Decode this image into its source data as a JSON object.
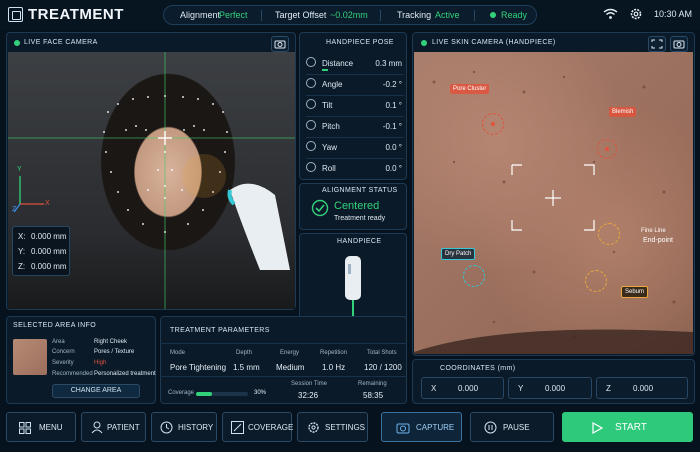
{
  "app": {
    "title": "TREATMENT"
  },
  "status": {
    "alignment_label": "Alignment",
    "alignment_value": "Perfect",
    "target_label": "Target Offset",
    "target_value": "~0.02mm",
    "tracking_label": "Tracking",
    "tracking_value": "Active",
    "ready": "Ready"
  },
  "time": "10:30 AM",
  "face_camera": {
    "title": "LIVE FACE CAMERA",
    "axes": {
      "y": "Y",
      "x": "X",
      "z": "Z"
    },
    "coords": [
      {
        "k": "X:",
        "v": "0.000 mm"
      },
      {
        "k": "Y:",
        "v": "0.000 mm"
      },
      {
        "k": "Z:",
        "v": "0.000 mm"
      }
    ]
  },
  "handpiece_pose": {
    "title": "HANDPIECE POSE",
    "rows": [
      {
        "label": "Distance",
        "value": "0.3 mm",
        "icon": "distance-icon"
      },
      {
        "label": "Angle",
        "value": "-0.2 °",
        "icon": "angle-icon"
      },
      {
        "label": "Tilt",
        "value": "0.1 °",
        "icon": "tilt-icon"
      },
      {
        "label": "Pitch",
        "value": "-0.1 °",
        "icon": "pitch-icon"
      },
      {
        "label": "Yaw",
        "value": "0.0 °",
        "icon": "yaw-icon"
      },
      {
        "label": "Roll",
        "value": "0.0 °",
        "icon": "roll-icon"
      }
    ]
  },
  "alignment_status": {
    "title": "ALIGNMENT STATUS",
    "state": "Centered",
    "detail": "Treatment ready"
  },
  "handpiece": {
    "title": "HANDPIECE"
  },
  "skin_camera": {
    "title": "LIVE SKIN CAMERA (HANDPIECE)",
    "annotations": [
      {
        "label": "Pore Cluster",
        "color": "#e0523c"
      },
      {
        "label": "Blemish",
        "color": "#e0523c"
      },
      {
        "label": "Fine Line",
        "sub": "End-point",
        "color": "#e8a93a"
      },
      {
        "label": "Dry Patch",
        "color": "#35c7d6"
      },
      {
        "label": "Sebum",
        "color": "#e8a93a"
      }
    ]
  },
  "selected_area": {
    "title": "SELECTED AREA INFO",
    "rows": [
      {
        "k": "Area",
        "v": "Right Cheek"
      },
      {
        "k": "Concern",
        "v": "Pores / Texture"
      },
      {
        "k": "Severity",
        "v": "High"
      },
      {
        "k": "Recommended",
        "v": "Personalized treatment"
      }
    ],
    "change": "CHANGE AREA"
  },
  "treatment": {
    "title": "TREATMENT PARAMETERS",
    "cols": [
      {
        "k": "Mode",
        "v": "Pore Tightening"
      },
      {
        "k": "Depth",
        "v": "1.5 mm"
      },
      {
        "k": "Energy",
        "v": "Medium"
      },
      {
        "k": "Repetition",
        "v": "1.0 Hz"
      },
      {
        "k": "Total Shots",
        "v": "120 / 1200"
      }
    ],
    "coverage_label": "Coverage",
    "coverage_value": "30%",
    "coverage_fraction": 0.3,
    "session_label": "Session Time",
    "session_value": "32:26",
    "remaining_label": "Remaining",
    "remaining_value": "58:35"
  },
  "coordinates": {
    "title": "COORDINATES (mm)",
    "x_label": "X",
    "x_value": "0.000",
    "y_label": "Y",
    "y_value": "0.000",
    "z_label": "Z",
    "z_value": "0.000"
  },
  "controls": {
    "menu": "MENU",
    "patient": "PATIENT",
    "history": "HISTORY",
    "coverage": "COVERAGE",
    "settings": "SETTINGS",
    "capture": "CAPTURE",
    "pause": "PAUSE",
    "start": "START"
  },
  "colors": {
    "accent": "#32d27a",
    "danger": "#e0523c",
    "start": "#2fc97b"
  }
}
